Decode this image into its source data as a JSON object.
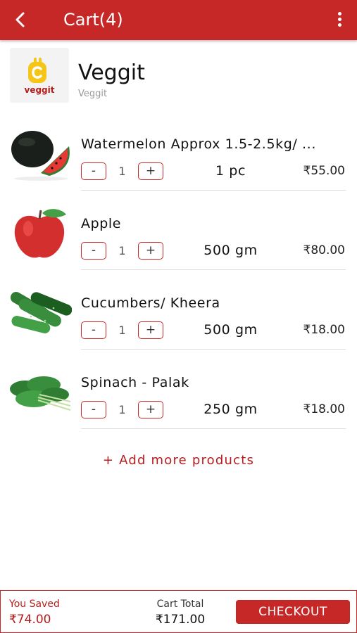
{
  "header": {
    "title": "Cart(4)"
  },
  "store": {
    "logo_text": "veggit",
    "name": "Veggit",
    "subtitle": "Veggit"
  },
  "items": [
    {
      "name": "Watermelon Approx 1.5-2.5kg/ ...",
      "qty": "1",
      "unit": "1 pc",
      "price": "₹55.00",
      "image": "watermelon"
    },
    {
      "name": "Apple",
      "qty": "1",
      "unit": "500 gm",
      "price": "₹80.00",
      "image": "apple"
    },
    {
      "name": "Cucumbers/ Kheera",
      "qty": "1",
      "unit": "500 gm",
      "price": "₹18.00",
      "image": "cucumber"
    },
    {
      "name": "Spinach - Palak",
      "qty": "1",
      "unit": "250 gm",
      "price": "₹18.00",
      "image": "spinach"
    }
  ],
  "controls": {
    "minus": "-",
    "plus": "+"
  },
  "add_more": "+ Add more products",
  "footer": {
    "saved_label": "You Saved",
    "saved_value": "₹74.00",
    "total_label": "Cart Total",
    "total_value": "₹171.00",
    "checkout_label": "CHECKOUT"
  },
  "colors": {
    "brand": "#c62828",
    "brand_text": "#b71c1c",
    "logo_yellow": "#f5c518"
  }
}
